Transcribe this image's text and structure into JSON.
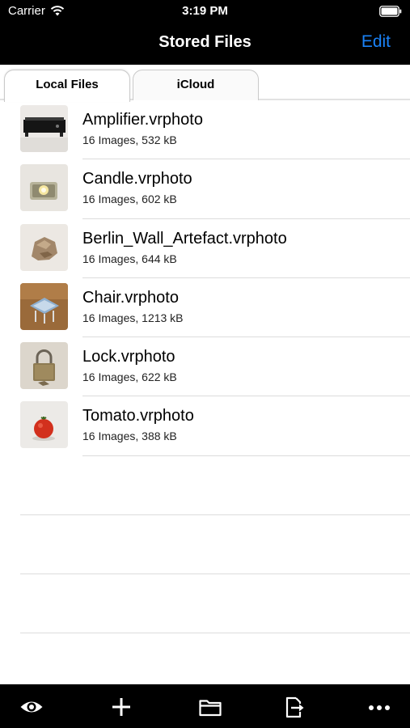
{
  "status_bar": {
    "carrier": "Carrier",
    "time": "3:19 PM"
  },
  "nav": {
    "title": "Stored Files",
    "edit_label": "Edit",
    "accent": "#1a82f7"
  },
  "tabs": [
    {
      "label": "Local Files",
      "selected": true
    },
    {
      "label": "iCloud",
      "selected": false
    }
  ],
  "files": [
    {
      "name": "Amplifier.vrphoto",
      "details": "16 Images, 532 kB"
    },
    {
      "name": "Candle.vrphoto",
      "details": "16 Images, 602 kB"
    },
    {
      "name": "Berlin_Wall_Artefact.vrphoto",
      "details": "16 Images, 644 kB"
    },
    {
      "name": "Chair.vrphoto",
      "details": "16 Images, 1213 kB"
    },
    {
      "name": "Lock.vrphoto",
      "details": "16 Images, 622 kB"
    },
    {
      "name": "Tomato.vrphoto",
      "details": "16 Images, 388 kB"
    }
  ],
  "toolbar": {
    "icons": [
      "eye-icon",
      "plus-icon",
      "folder-icon",
      "export-icon",
      "more-icon"
    ]
  }
}
